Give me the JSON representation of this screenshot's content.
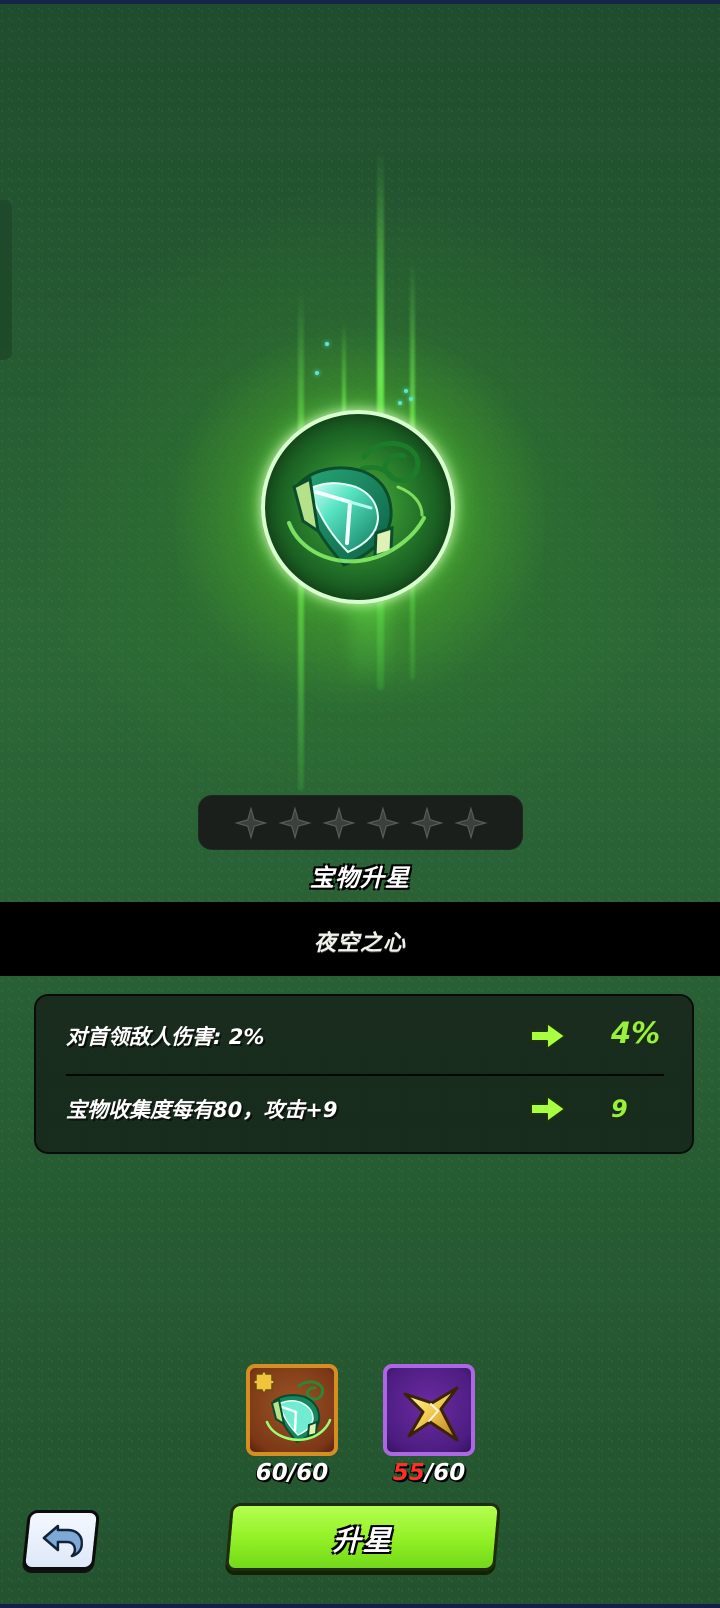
{
  "screen": {
    "section_title": "宝物升星",
    "treasure_name": "夜空之心",
    "star_rating": {
      "filled": 0,
      "total": 6
    }
  },
  "stats": [
    {
      "label": "对首领敌人伤害: 2%",
      "next_value": "4%"
    },
    {
      "label": "宝物收集度每有80，攻击+9",
      "next_value": "9"
    }
  ],
  "materials": [
    {
      "icon": "treasure-shard-icon",
      "count_current": "60",
      "count_separator": "/",
      "count_required": "60"
    },
    {
      "icon": "star-stone-icon",
      "count_current": "55",
      "count_separator": "/",
      "count_required": "60"
    }
  ],
  "buttons": {
    "upgrade_label": "升星",
    "back_icon": "back-arrow-icon"
  },
  "colors": {
    "accent_green": "#99f03a",
    "button_green": "#91ef24",
    "shard_border": "#d48e21",
    "star_border": "#ae67e4",
    "insufficient_red": "#ff2f2a"
  }
}
